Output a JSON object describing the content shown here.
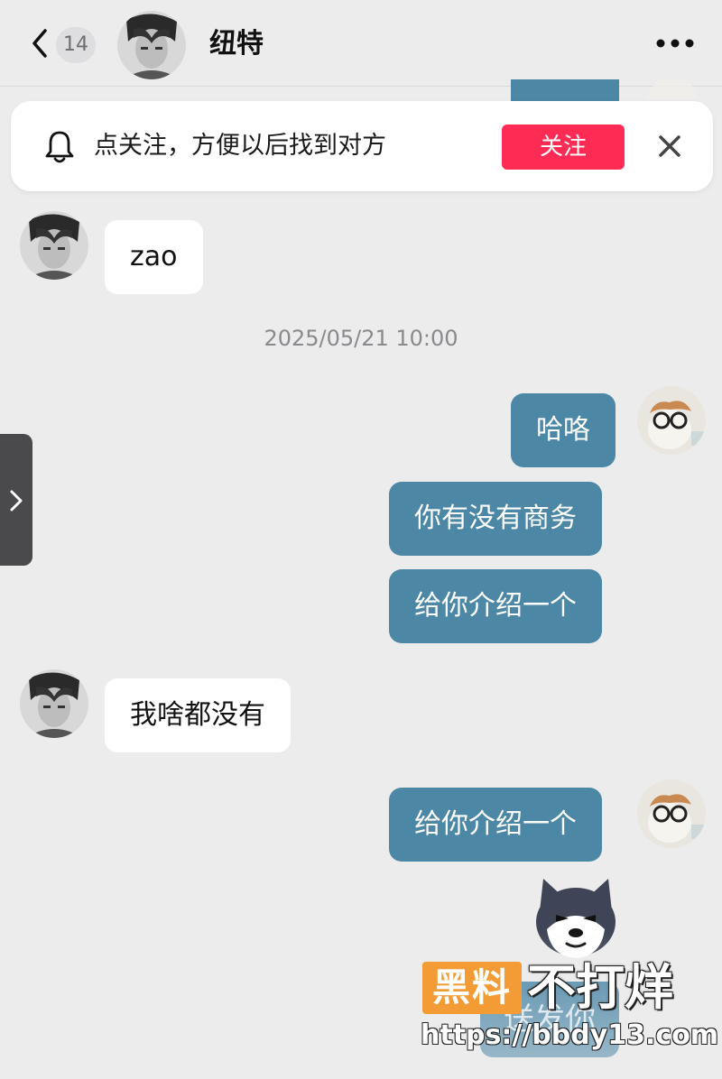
{
  "header": {
    "unread_count": "14",
    "contact_name": "纽特"
  },
  "follow_banner": {
    "text": "点关注，方便以后找到对方",
    "button_label": "关注"
  },
  "messages": {
    "m1": "zao",
    "timestamp": "2025/05/21 10:00",
    "m2": "哈咯",
    "m3": "你有没有商务",
    "m4": "给你介绍一个",
    "m5": "我啥都没有",
    "m6": "给你介绍一个",
    "m7": "送发你"
  },
  "watermark": {
    "logo": "黑料",
    "text": "不打烊",
    "url": "https://bbdy13.com"
  },
  "colors": {
    "outgoing_bubble": "#4c87a6",
    "incoming_bubble": "#ffffff",
    "follow_button": "#fe2c55",
    "background": "#ececed"
  }
}
